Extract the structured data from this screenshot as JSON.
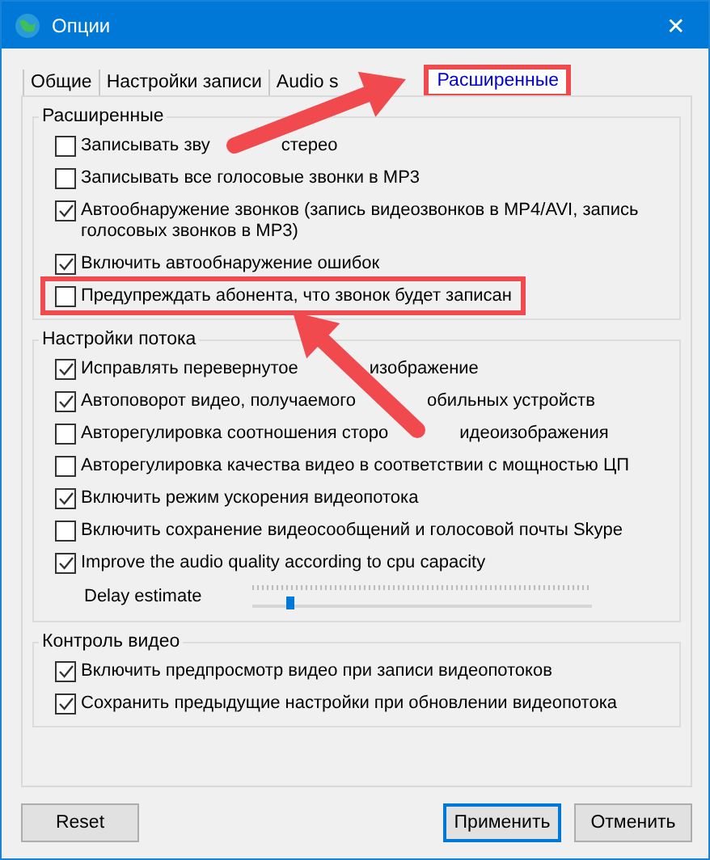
{
  "window": {
    "title": "Опции",
    "close": "✕"
  },
  "tabs": [
    {
      "label_parts": [
        "Общие"
      ],
      "selected": false,
      "highlighted": false
    },
    {
      "label_parts": [
        "Настройки записи"
      ],
      "selected": false,
      "highlighted": false
    },
    {
      "label_parts": [
        "Audio s"
      ],
      "covered": true,
      "selected": false,
      "highlighted": false
    },
    {
      "label_parts": [
        "Расширенные"
      ],
      "selected": true,
      "highlighted": true
    }
  ],
  "groups": [
    {
      "title": "Расширенные",
      "items": [
        {
          "kind": "checkbox",
          "label_parts": [
            "Записывать зву",
            "стерео"
          ],
          "checked": false,
          "highlighted": false
        },
        {
          "kind": "checkbox",
          "label_parts": [
            "Записывать все голосовые звонки в MP3"
          ],
          "checked": false,
          "highlighted": false
        },
        {
          "kind": "checkbox",
          "label_parts": [
            "Автообнаружение звонков (запись видеозвонков в MP4/AVI, запись голосовых звонков в MP3)"
          ],
          "checked": true,
          "highlighted": false
        },
        {
          "kind": "checkbox",
          "label_parts": [
            "Включить автообнаружение ошибок"
          ],
          "checked": true,
          "highlighted": false
        },
        {
          "kind": "checkbox",
          "label_parts": [
            "Предупреждать абонента, что звонок будет записан"
          ],
          "checked": false,
          "highlighted": true
        }
      ]
    },
    {
      "title": "Настройки потока",
      "items": [
        {
          "kind": "checkbox",
          "label_parts": [
            "Исправлять перевернутое",
            "изображение"
          ],
          "checked": true,
          "highlighted": false
        },
        {
          "kind": "checkbox",
          "label_parts": [
            "Автоповорот видео, получаемого",
            "обильных устройств"
          ],
          "checked": true,
          "highlighted": false
        },
        {
          "kind": "checkbox",
          "label_parts": [
            "Авторегулировка соотношения сторо",
            "идеоизображения"
          ],
          "checked": false,
          "highlighted": false
        },
        {
          "kind": "checkbox",
          "label_parts": [
            "Авторегулировка качества видео в соответствии с мощностью ЦП"
          ],
          "checked": false,
          "highlighted": false
        },
        {
          "kind": "checkbox",
          "label_parts": [
            "Включить режим ускорения видеопотока"
          ],
          "checked": true,
          "highlighted": false
        },
        {
          "kind": "checkbox",
          "label_parts": [
            "Включить сохранение видеосообщений и голосовой почты Skype"
          ],
          "checked": false,
          "highlighted": false
        },
        {
          "kind": "checkbox",
          "label_parts": [
            "Improve the audio quality according to cpu capacity"
          ],
          "checked": true,
          "highlighted": false
        },
        {
          "kind": "slider",
          "label": "Delay estimate",
          "level": 0.11
        }
      ]
    },
    {
      "title": "Контроль видео",
      "items": [
        {
          "kind": "checkbox",
          "label_parts": [
            "Включить предпросмотр видео при записи видеопотоков"
          ],
          "checked": true,
          "highlighted": false
        },
        {
          "kind": "checkbox",
          "label_parts": [
            "Сохранить предыдущие настройки при обновлении видеопотока"
          ],
          "checked": true,
          "highlighted": false
        }
      ]
    }
  ],
  "buttons": [
    {
      "label": "Reset",
      "default": false
    },
    {
      "label": "Применить",
      "default": true
    },
    {
      "label": "Отменить",
      "default": false
    }
  ]
}
